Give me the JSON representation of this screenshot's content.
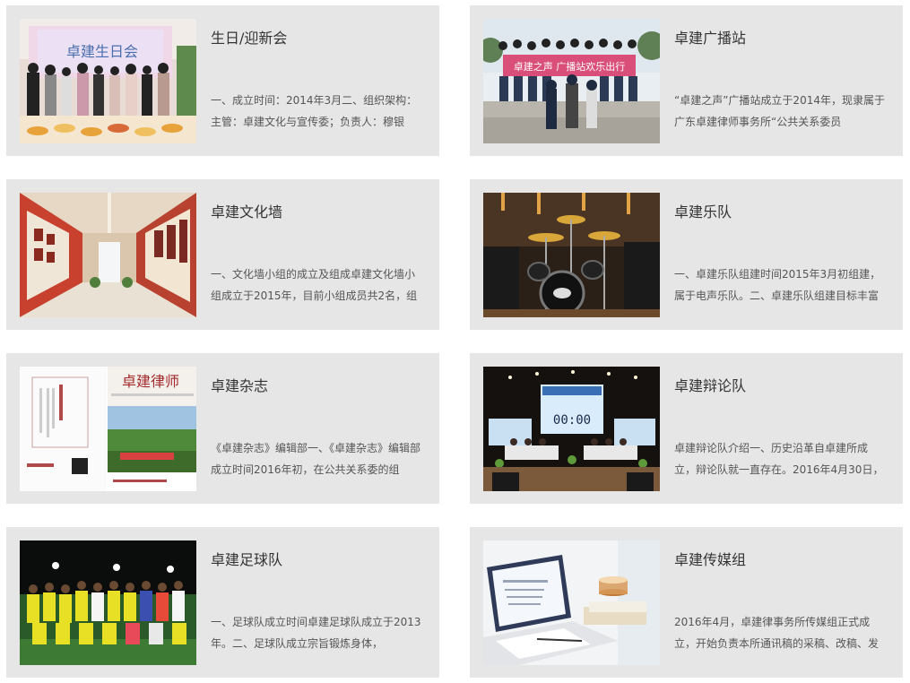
{
  "cards": [
    {
      "title": "生日/迎新会",
      "desc": "一、成立时间：2014年3月二、组织架构：主管：卓建文化与宣传委；负责人：穆银",
      "banner": "卓建生日会"
    },
    {
      "title": "卓建广播站",
      "desc": "“卓建之声”广播站成立于2014年，现隶属于广东卓建律师事务所“公共关系委员",
      "banner": "卓建之声 广播站欢乐出行"
    },
    {
      "title": "卓建文化墙",
      "desc": "一、文化墙小组的成立及组成卓建文化墙小组成立于2015年，目前小组成员共2名，组",
      "banner": ""
    },
    {
      "title": "卓建乐队",
      "desc": "一、卓建乐队组建时间2015年3月初组建，属于电声乐队。二、卓建乐队组建目标丰富",
      "banner": ""
    },
    {
      "title": "卓建杂志",
      "desc": "《卓建杂志》编辑部一、《卓建杂志》编辑部成立时间2016年初，在公共关系委的组",
      "banner": "卓建律师"
    },
    {
      "title": "卓建辩论队",
      "desc": "卓建辩论队介绍一、历史沿革自卓建所成立，辩论队就一直存在。2016年4月30日，",
      "banner": "00:00"
    },
    {
      "title": "卓建足球队",
      "desc": "一、足球队成立时间卓建足球队成立于2013年。二、足球队成立宗旨锻炼身体，",
      "banner": ""
    },
    {
      "title": "卓建传媒组",
      "desc": "2016年4月，卓建律事务所传媒组正式成立，开始负责本所通讯稿的采稿、改稿、发",
      "banner": ""
    }
  ]
}
